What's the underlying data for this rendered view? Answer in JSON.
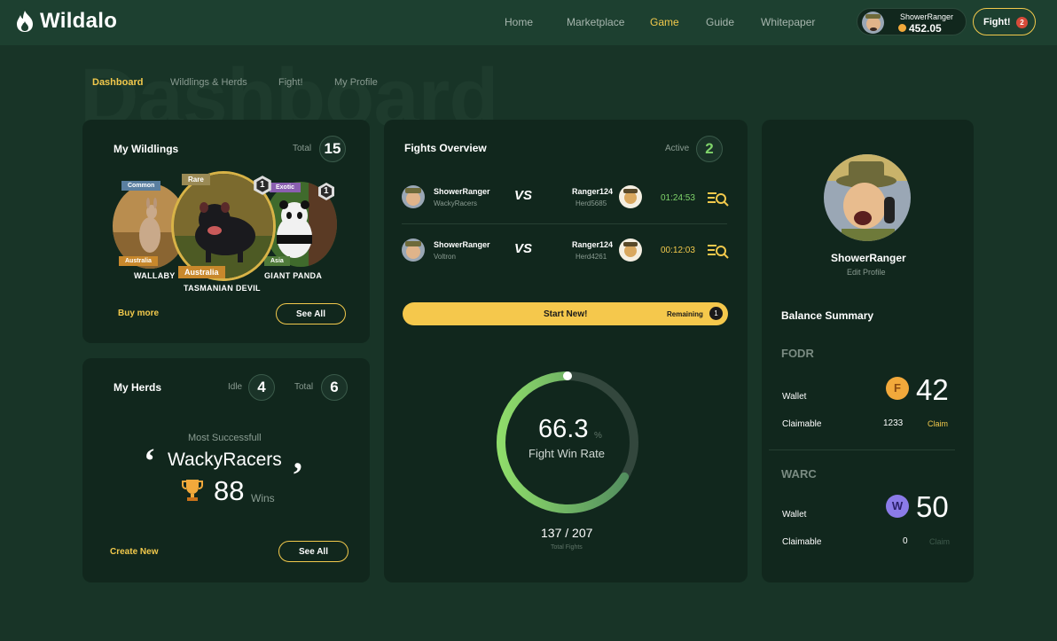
{
  "brand": {
    "name": "Wildalo"
  },
  "nav": {
    "items": [
      "Home",
      "Marketplace",
      "Game",
      "Guide",
      "Whitepaper"
    ],
    "active": "Game"
  },
  "user": {
    "name": "ShowerRanger",
    "balance": "452.05"
  },
  "fight_button": {
    "label": "Fight!",
    "count": "2"
  },
  "watermark": "Dashboard",
  "subtabs": [
    "Dashboard",
    "Wildlings & Herds",
    "Fight!",
    "My Profile"
  ],
  "wildlings": {
    "title": "My Wildlings",
    "total_label": "Total",
    "total": "15",
    "cards": [
      {
        "name": "WALLABY",
        "rarity": "Common",
        "region": "Australia"
      },
      {
        "name": "TASMANIAN DEVIL",
        "rarity": "Rare",
        "region": "Australia",
        "level": "1"
      },
      {
        "name": "GIANT PANDA",
        "rarity": "Exotic",
        "region": "Asia",
        "level": "1"
      }
    ],
    "buy_more": "Buy more",
    "see_all": "See All"
  },
  "herds": {
    "title": "My Herds",
    "idle_label": "Idle",
    "idle": "4",
    "total_label": "Total",
    "total": "6",
    "most_label": "Most Successfull",
    "top_herd": "WackyRacers",
    "wins": "88",
    "wins_label": "Wins",
    "create_new": "Create New",
    "see_all": "See All"
  },
  "fights": {
    "title": "Fights Overview",
    "active_label": "Active",
    "active": "2",
    "vs": "VS",
    "rows": [
      {
        "p1": "ShowerRanger",
        "herd1": "WackyRacers",
        "p2": "Ranger124",
        "herd2": "Herd5685",
        "time": "01:24:53"
      },
      {
        "p1": "ShowerRanger",
        "herd1": "Voltron",
        "p2": "Ranger124",
        "herd2": "Herd4261",
        "time": "00:12:03"
      }
    ],
    "start_new": "Start New!",
    "remaining_label": "Remaining",
    "remaining": "1",
    "win_rate": "66.3",
    "win_rate_unit": "%",
    "win_rate_fraction": 0.663,
    "win_rate_label": "Fight Win Rate",
    "fights_count": "137 / 207",
    "fights_count_label": "Total Fights"
  },
  "profile": {
    "name": "ShowerRanger",
    "edit": "Edit Profile",
    "balance_title": "Balance Summary",
    "tokens": [
      {
        "symbol": "FODR",
        "wallet_label": "Wallet",
        "wallet": "42",
        "claimable_label": "Claimable",
        "claimable": "1233",
        "claim": "Claim",
        "icon_letter": "F",
        "color": "#f2a93b"
      },
      {
        "symbol": "WARC",
        "wallet_label": "Wallet",
        "wallet": "50",
        "claimable_label": "Claimable",
        "claimable": "0",
        "claim": "Claim",
        "icon_letter": "W",
        "color": "#8b7be8"
      }
    ]
  },
  "colors": {
    "accent": "#f2c94c",
    "green": "#7fd36a",
    "bg": "#183427",
    "card": "#11271d"
  }
}
